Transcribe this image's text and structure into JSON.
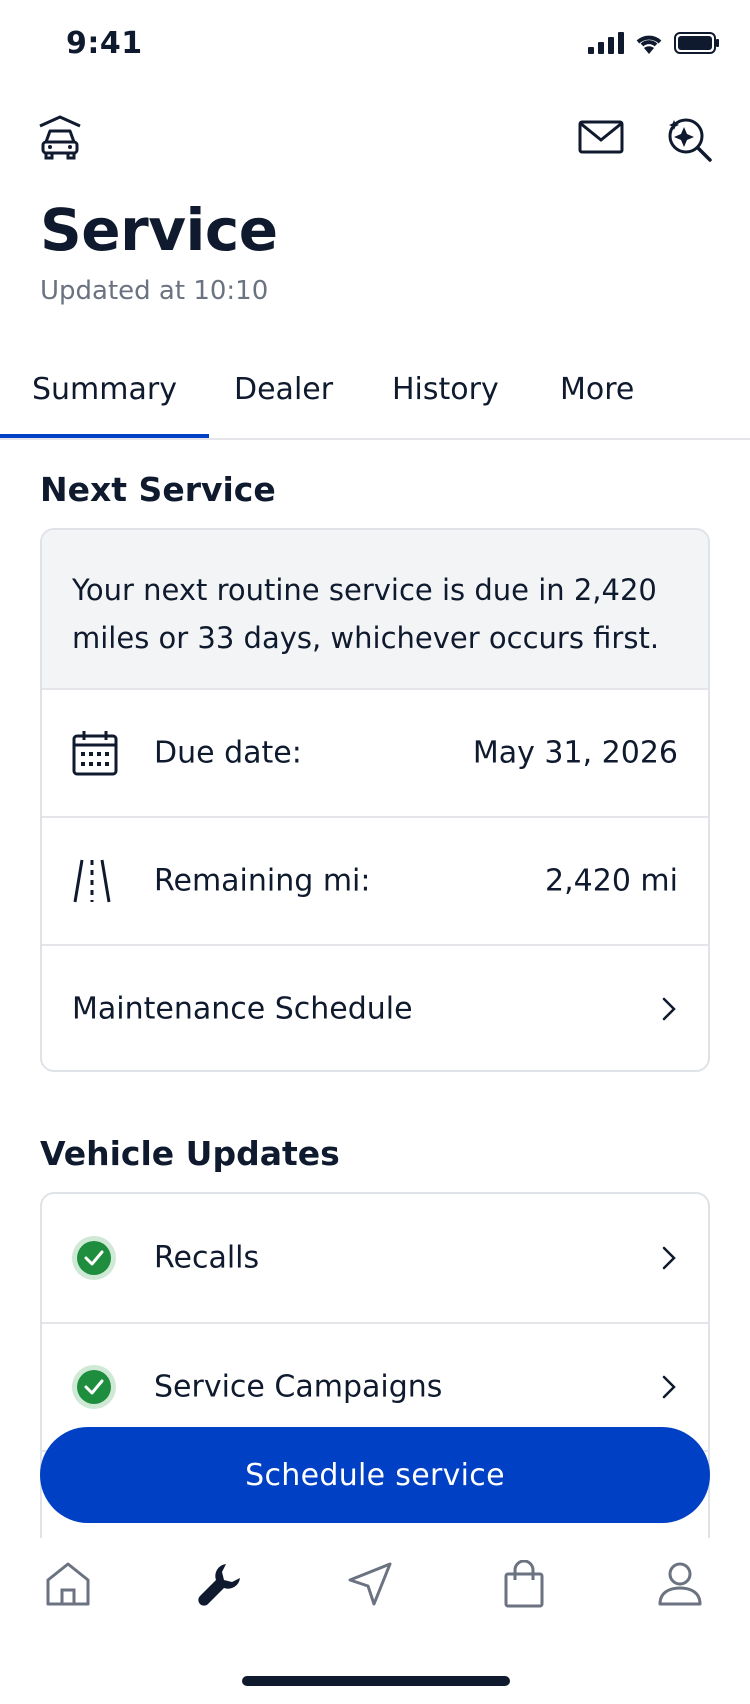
{
  "status_bar": {
    "time": "9:41"
  },
  "header": {
    "title": "Service",
    "updated": "Updated at 10:10"
  },
  "tabs": [
    {
      "label": "Summary",
      "active": true
    },
    {
      "label": "Dealer",
      "active": false
    },
    {
      "label": "History",
      "active": false
    },
    {
      "label": "More",
      "active": false
    }
  ],
  "next_service": {
    "heading": "Next Service",
    "banner": "Your next routine service is due in 2,420 miles or 33 days, whichever occurs first.",
    "due_date_label": "Due date:",
    "due_date_value": "May 31, 2026",
    "remaining_label": "Remaining mi:",
    "remaining_value": "2,420 mi",
    "schedule_link": "Maintenance Schedule"
  },
  "vehicle_updates": {
    "heading": "Vehicle Updates",
    "items": [
      {
        "label": "Recalls",
        "status": "ok"
      },
      {
        "label": "Service Campaigns",
        "status": "ok"
      }
    ]
  },
  "cta": {
    "label": "Schedule service"
  },
  "tabbar": {
    "items": [
      "home-icon",
      "wrench-icon",
      "navigation-icon",
      "shopping-bag-icon",
      "profile-icon"
    ],
    "active_index": 1
  },
  "colors": {
    "accent": "#0040c5",
    "text": "#0f1a2e",
    "success": "#1e8e3e",
    "muted": "#6b7280"
  }
}
